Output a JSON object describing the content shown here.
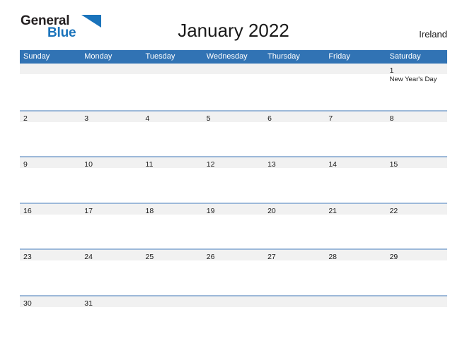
{
  "brand": {
    "word1": "General",
    "word2": "Blue",
    "mark": "triangle-logo-mark",
    "mark_color": "#1a73bb"
  },
  "header": {
    "title": "January 2022",
    "region": "Ireland"
  },
  "colors": {
    "header_blue": "#3173b4",
    "row_separator_blue": "#9db9d9",
    "daynum_band_gray": "#f1f1f1",
    "brand_blue": "#1a73bb",
    "text": "#1a1a1a"
  },
  "calendar": {
    "weekday_headers": [
      "Sunday",
      "Monday",
      "Tuesday",
      "Wednesday",
      "Thursday",
      "Friday",
      "Saturday"
    ],
    "weeks": [
      {
        "days": [
          {
            "num": "",
            "event": ""
          },
          {
            "num": "",
            "event": ""
          },
          {
            "num": "",
            "event": ""
          },
          {
            "num": "",
            "event": ""
          },
          {
            "num": "",
            "event": ""
          },
          {
            "num": "",
            "event": ""
          },
          {
            "num": "1",
            "event": "New Year's Day"
          }
        ]
      },
      {
        "days": [
          {
            "num": "2",
            "event": ""
          },
          {
            "num": "3",
            "event": ""
          },
          {
            "num": "4",
            "event": ""
          },
          {
            "num": "5",
            "event": ""
          },
          {
            "num": "6",
            "event": ""
          },
          {
            "num": "7",
            "event": ""
          },
          {
            "num": "8",
            "event": ""
          }
        ]
      },
      {
        "days": [
          {
            "num": "9",
            "event": ""
          },
          {
            "num": "10",
            "event": ""
          },
          {
            "num": "11",
            "event": ""
          },
          {
            "num": "12",
            "event": ""
          },
          {
            "num": "13",
            "event": ""
          },
          {
            "num": "14",
            "event": ""
          },
          {
            "num": "15",
            "event": ""
          }
        ]
      },
      {
        "days": [
          {
            "num": "16",
            "event": ""
          },
          {
            "num": "17",
            "event": ""
          },
          {
            "num": "18",
            "event": ""
          },
          {
            "num": "19",
            "event": ""
          },
          {
            "num": "20",
            "event": ""
          },
          {
            "num": "21",
            "event": ""
          },
          {
            "num": "22",
            "event": ""
          }
        ]
      },
      {
        "days": [
          {
            "num": "23",
            "event": ""
          },
          {
            "num": "24",
            "event": ""
          },
          {
            "num": "25",
            "event": ""
          },
          {
            "num": "26",
            "event": ""
          },
          {
            "num": "27",
            "event": ""
          },
          {
            "num": "28",
            "event": ""
          },
          {
            "num": "29",
            "event": ""
          }
        ]
      },
      {
        "days": [
          {
            "num": "30",
            "event": ""
          },
          {
            "num": "31",
            "event": ""
          },
          {
            "num": "",
            "event": ""
          },
          {
            "num": "",
            "event": ""
          },
          {
            "num": "",
            "event": ""
          },
          {
            "num": "",
            "event": ""
          },
          {
            "num": "",
            "event": ""
          }
        ]
      }
    ]
  }
}
